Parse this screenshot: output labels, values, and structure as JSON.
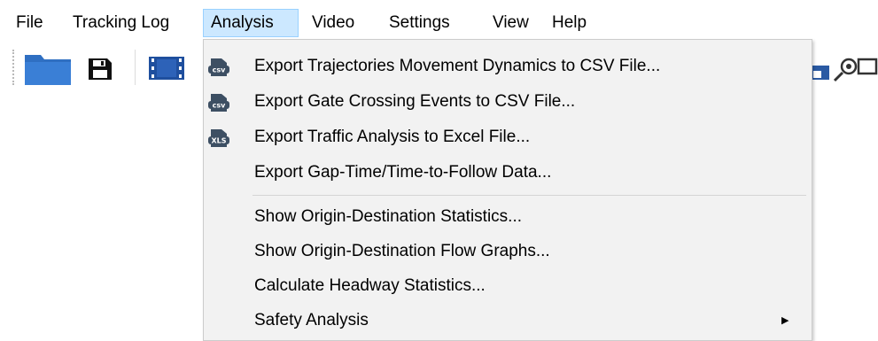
{
  "menubar": {
    "items": [
      {
        "label": "File"
      },
      {
        "label": "Tracking Log"
      },
      {
        "label": "Analysis",
        "active": true
      },
      {
        "label": "Video"
      },
      {
        "label": "Settings"
      },
      {
        "label": "View"
      },
      {
        "label": "Help"
      }
    ]
  },
  "toolbar": {
    "buttons": [
      {
        "icon": "folder-open-icon"
      },
      {
        "icon": "save-icon"
      },
      {
        "icon": "video-film-icon"
      },
      {
        "icon": "partial-icon"
      },
      {
        "icon": "zoom-icon"
      }
    ]
  },
  "analysis_menu": {
    "items": [
      {
        "label": "Export Trajectories Movement Dynamics to CSV File...",
        "icon": "csv-file-icon",
        "icon_text": "csv"
      },
      {
        "label": "Export Gate Crossing Events to CSV File...",
        "icon": "csv-file-icon",
        "icon_text": "csv"
      },
      {
        "label": "Export Traffic Analysis to Excel File...",
        "icon": "xls-file-icon",
        "icon_text": "XLS"
      },
      {
        "label": "Export Gap-Time/Time-to-Follow Data..."
      },
      {
        "label": "Show Origin-Destination Statistics..."
      },
      {
        "label": "Show Origin-Destination Flow Graphs..."
      },
      {
        "label": "Calculate Headway Statistics..."
      },
      {
        "label": "Safety Analysis",
        "has_submenu": true
      }
    ]
  },
  "colors": {
    "menu_active_bg": "#cce8ff",
    "menu_active_border": "#99d1ff",
    "dropdown_bg": "#f2f2f2",
    "folder_blue": "#2f6fc2",
    "film_blue": "#1f4f9e",
    "file_icon_dark": "#3d4f63"
  }
}
